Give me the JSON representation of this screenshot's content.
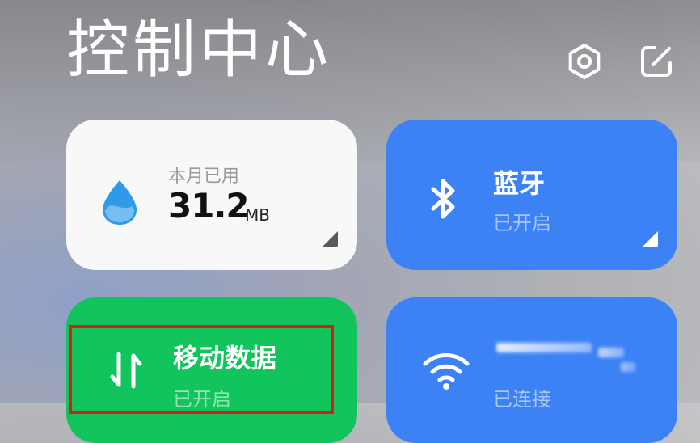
{
  "header": {
    "title": "控制中心",
    "settings_icon": "gear-icon",
    "edit_icon": "edit-icon"
  },
  "tiles": {
    "data_usage": {
      "label": "本月已用",
      "value": "31.2",
      "unit": "MB",
      "icon": "water-drop-icon"
    },
    "bluetooth": {
      "title": "蓝牙",
      "status": "已开启",
      "icon": "bluetooth-icon"
    },
    "mobile_data": {
      "title": "移动数据",
      "status": "已开启",
      "icon": "mobile-data-arrows-icon"
    },
    "wifi": {
      "status": "已连接",
      "icon": "wifi-icon"
    }
  },
  "colors": {
    "blue_tile": "#3d82f5",
    "green_tile": "#11c45c",
    "white_tile": "#f8f8f8",
    "highlight": "#e01a1a"
  }
}
